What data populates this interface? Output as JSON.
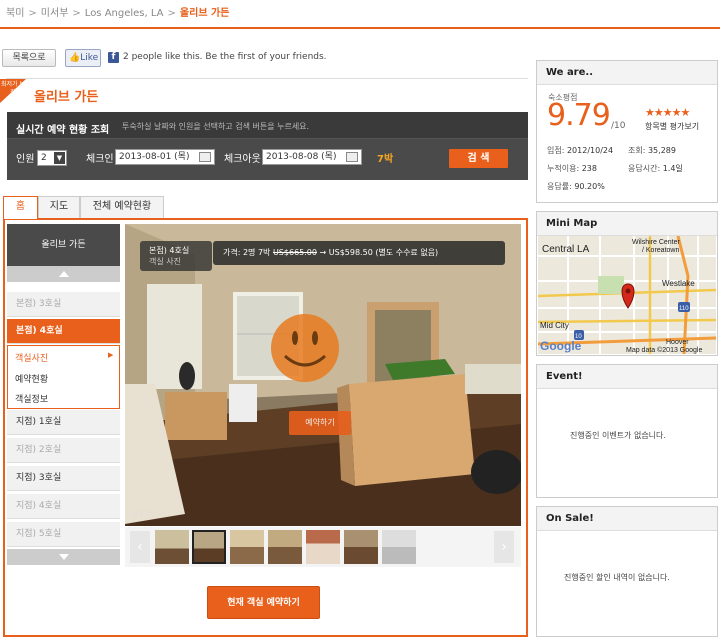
{
  "breadcrumb": {
    "items": [
      "북미",
      "미서부",
      "Los Angeles, LA"
    ],
    "current": "올리브 가든"
  },
  "toolbar": {
    "list_label": "목록으로",
    "like_label": "Like",
    "fb_text": "2 people like this. Be the first of your friends."
  },
  "hotel": {
    "badge": "최저가 보장",
    "title": "올리브 가든"
  },
  "booking": {
    "title": "실시간 예약 현황 조회",
    "help": "투숙하실 날짜와 인원을 선택하고 검색 버튼을 누르세요.",
    "people_label": "인원",
    "people_value": "2",
    "checkin_label": "체크인",
    "checkin_value": "2013-08-01 (목)",
    "checkout_label": "체크아웃",
    "checkout_value": "2013-08-08 (목)",
    "nights": "7박",
    "search_label": "검 색"
  },
  "tabs": [
    "홈",
    "지도",
    "전체 예약현황"
  ],
  "menu": {
    "header": "올리브 가든",
    "items": [
      {
        "label": "본점) 3호실",
        "state": "dim"
      },
      {
        "label": "본점) 4호실",
        "state": "active"
      },
      {
        "label": "지점) 1호실",
        "state": "normal"
      },
      {
        "label": "지점) 2호실",
        "state": "dim"
      },
      {
        "label": "지점) 3호실",
        "state": "normal"
      },
      {
        "label": "지점) 4호실",
        "state": "dim"
      },
      {
        "label": "지점) 5호실",
        "state": "dim"
      }
    ],
    "submenu": [
      "객실사진",
      "예약현황",
      "객실정보"
    ]
  },
  "photo": {
    "room_name": "본점) 4호실",
    "room_sub": "객실 사진",
    "price_prefix": "가격: 2명 7박",
    "price_old": "US$665.00",
    "price_arrow": "→",
    "price_new": "US$598.50 (별도 수수료 없음)",
    "reserve_label": "예약하기",
    "page": "2 / 7"
  },
  "main_reserve_label": "현재 객실 예약하기",
  "we_are": {
    "title": "We are..",
    "score_label": "숙소평점",
    "score": "9.79",
    "score_max": "/10",
    "stars": "★★★★★",
    "star_rating": 5,
    "star_label": "항목별 평가보기",
    "join_label": "입점:",
    "join_value": "2012/10/24",
    "views_label": "조회:",
    "views_value": "35,289",
    "cumulative_label": "누적이용:",
    "cumulative_value": "238",
    "response_time_label": "응답시간:",
    "response_time_value": "1.4일",
    "response_rate_label": "응답률:",
    "response_rate_value": "90.20%"
  },
  "mini_map": {
    "title": "Mini Map",
    "labels": [
      "Central LA",
      "Wilshire Center",
      "/ Koreatown",
      "Westlake",
      "Mid City",
      "Hoover",
      "Google",
      "Map data ©2013 Google"
    ],
    "shields": [
      "110",
      "10"
    ]
  },
  "event": {
    "title": "Event!",
    "empty": "진행중인 이벤트가 없습니다."
  },
  "sale": {
    "title": "On Sale!",
    "empty": "진행중인 할인 내역이 없습니다."
  },
  "colors": {
    "accent": "#e8601c",
    "dark": "#4a4a4a"
  }
}
